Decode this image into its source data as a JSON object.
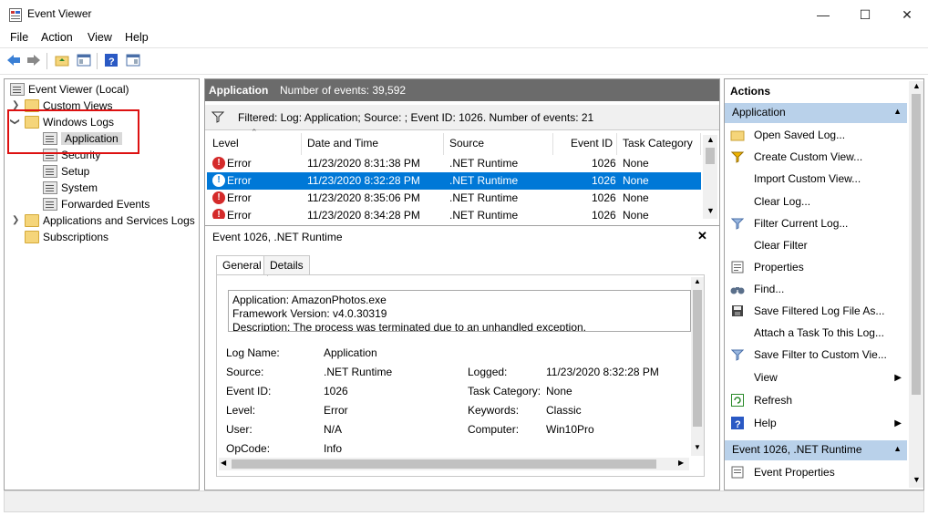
{
  "window": {
    "title": "Event Viewer"
  },
  "menu": {
    "file": "File",
    "action": "Action",
    "view": "View",
    "help": "Help"
  },
  "tree": {
    "root": "Event Viewer (Local)",
    "custom_views": "Custom Views",
    "windows_logs": "Windows Logs",
    "application": "Application",
    "security": "Security",
    "setup": "Setup",
    "system": "System",
    "forwarded": "Forwarded Events",
    "apps_services": "Applications and Services Logs",
    "subscriptions": "Subscriptions"
  },
  "center": {
    "log_name": "Application",
    "event_count": "Number of events: 39,592",
    "filter_text": "Filtered: Log: Application; Source: ; Event ID: 1026. Number of events: 21",
    "columns": [
      "Level",
      "Date and Time",
      "Source",
      "Event ID",
      "Task Category"
    ],
    "rows": [
      {
        "level": "Error",
        "date": "11/23/2020 8:31:38 PM",
        "source": ".NET Runtime",
        "id": "1026",
        "category": "None"
      },
      {
        "level": "Error",
        "date": "11/23/2020 8:32:28 PM",
        "source": ".NET Runtime",
        "id": "1026",
        "category": "None"
      },
      {
        "level": "Error",
        "date": "11/23/2020 8:35:06 PM",
        "source": ".NET Runtime",
        "id": "1026",
        "category": "None"
      },
      {
        "level": "Error",
        "date": "11/23/2020 8:34:28 PM",
        "source": ".NET Runtime",
        "id": "1026",
        "category": "None"
      }
    ]
  },
  "detail": {
    "title": "Event 1026, .NET Runtime",
    "tab_general": "General",
    "tab_details": "Details",
    "desc_lines": [
      "Application: AmazonPhotos.exe",
      "Framework Version: v4.0.30319",
      "Description: The process was terminated due to an unhandled exception."
    ],
    "labels": {
      "log_name": "Log Name:",
      "source": "Source:",
      "event_id": "Event ID:",
      "level": "Level:",
      "user": "User:",
      "opcode": "OpCode:",
      "logged": "Logged:",
      "task_category": "Task Category:",
      "keywords": "Keywords:",
      "computer": "Computer:"
    },
    "values": {
      "log_name": "Application",
      "source": ".NET Runtime",
      "event_id": "1026",
      "level": "Error",
      "user": "N/A",
      "opcode": "Info",
      "logged": "11/23/2020 8:32:28 PM",
      "task_category": "None",
      "keywords": "Classic",
      "computer": "Win10Pro"
    }
  },
  "actions": {
    "header": "Actions",
    "section1": "Application",
    "items": [
      "Open Saved Log...",
      "Create Custom View...",
      "Import Custom View...",
      "Clear Log...",
      "Filter Current Log...",
      "Clear Filter",
      "Properties",
      "Find...",
      "Save Filtered Log File As...",
      "Attach a Task To this Log...",
      "Save Filter to Custom Vie...",
      "View",
      "Refresh",
      "Help"
    ],
    "section2": "Event 1026, .NET Runtime",
    "section2_items": [
      "Event Properties"
    ]
  }
}
